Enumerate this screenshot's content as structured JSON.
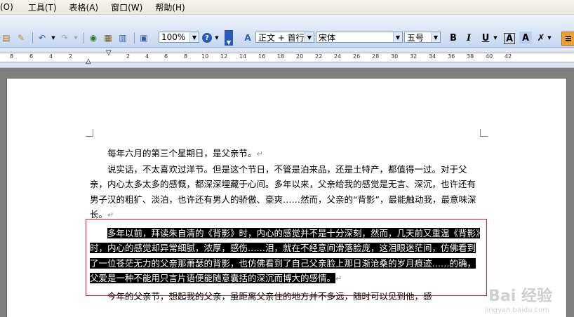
{
  "menu": {
    "items": [
      "(O)",
      "工具(T)",
      "表格(A)",
      "窗口(W)",
      "帮助(H)"
    ]
  },
  "toolbar": {
    "zoom": "100%",
    "style_label": "正文 + 首行",
    "font_name": "宋体",
    "font_size": "五号",
    "bold_label": "B",
    "italic_label": "I",
    "underline_label": "U",
    "font_color_label": "A",
    "char_border_label": "A"
  },
  "ruler": {
    "numbers": [
      "8",
      "6",
      "4",
      "2",
      "2",
      "4",
      "6",
      "8",
      "10",
      "12",
      "14",
      "16",
      "18",
      "20",
      "22",
      "24",
      "26",
      "28",
      "30",
      "32",
      "34",
      "36",
      "38",
      "40",
      "42"
    ]
  },
  "document": {
    "p1": "每年六月的第三个星期日，是父亲节。",
    "p2": "说实话，不太喜欢过洋节。但是这个节日，不管是泊来品，还是土特产，都值得一过。对于父亲，内心太多太多的感慨，都深深埋藏于心间。多年以来，父亲给我的感觉是无言、深沉，也许还有男子汉的粗犷、淡泊，也许还有男人的骄傲、豪爽……然而，父亲的“背影”，最能触动我，最意味深长。",
    "p3_selected": "多年以前，拜读朱自清的《背影》时，内心的感觉并不是十分深刻，然而，几天前又重温《背影》时，内心的感觉却异常细腻，浓厚，感伤……泪，就在不经意间滑落脸庞，这泪眼迷茫间，仿佛看到了一位苍茫无力的父亲那萧瑟的背影，也仿佛看到了自己父亲脸上那日渐沧桑的岁月痕迹……的确，父爱是一种不能用只言片语便能随意囊括的深沉而博大的感情。",
    "p4": "今年的父亲节，想起我的父亲，虽距离父亲住的地方并不多远，随时可以见到他，感",
    "para_mark": "↵"
  },
  "watermark": {
    "main": "Bai 经验",
    "sub": "jingyan.baidu.com"
  }
}
